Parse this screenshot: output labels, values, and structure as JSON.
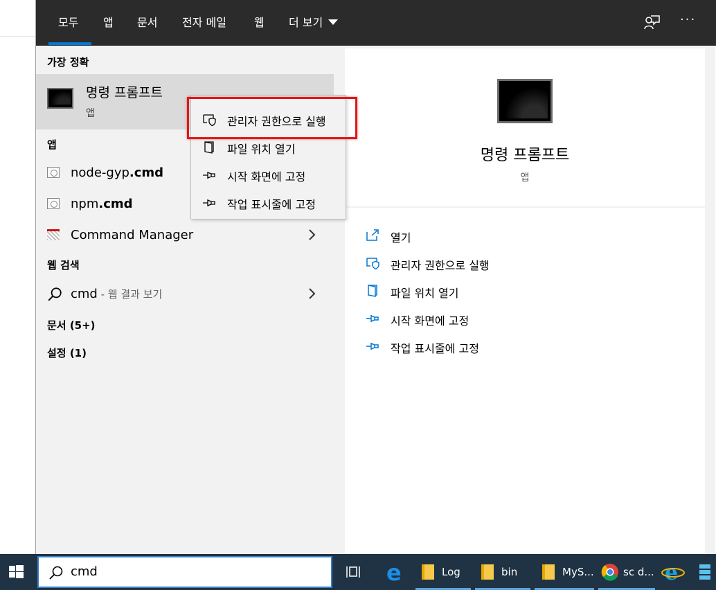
{
  "tabs": [
    {
      "label": "모두",
      "active": true
    },
    {
      "label": "앱"
    },
    {
      "label": "문서"
    },
    {
      "label": "전자 메일"
    },
    {
      "label": "웹"
    },
    {
      "label": "더 보기"
    }
  ],
  "top_icons": [
    "feedback-icon",
    "more-options-icon"
  ],
  "more_options_label": "···",
  "results": {
    "best_match_header": "가장 정확",
    "best_match": {
      "title": "명령 프롬프트",
      "subtitle": "앱",
      "icon": "command-prompt-icon"
    },
    "apps_header": "앱",
    "apps": [
      {
        "name": "node-gyp",
        "ext": ".cmd",
        "icon": "batch-file-icon"
      },
      {
        "name": "npm",
        "ext": ".cmd",
        "icon": "batch-file-icon"
      },
      {
        "name": "Command Manager",
        "icon": "command-manager-icon",
        "has_submenu": true
      }
    ],
    "web_header": "웹 검색",
    "web": {
      "query": "cmd",
      "suffix": " - 웹 결과 보기",
      "icon": "search-icon"
    },
    "docs_header": "문서 (5+)",
    "settings_header": "설정 (1)"
  },
  "context_menu": [
    {
      "label": "관리자 권한으로 실행",
      "icon": "shield-icon",
      "highlighted": true
    },
    {
      "label": "파일 위치 열기",
      "icon": "file-location-icon"
    },
    {
      "label": "시작 화면에 고정",
      "icon": "pin-icon"
    },
    {
      "label": "작업 표시줄에 고정",
      "icon": "pin-icon"
    }
  ],
  "details": {
    "title": "명령 프롬프트",
    "subtitle": "앱",
    "actions": [
      {
        "label": "열기",
        "icon": "open-icon"
      },
      {
        "label": "관리자 권한으로 실행",
        "icon": "shield-icon"
      },
      {
        "label": "파일 위치 열기",
        "icon": "file-location-icon"
      },
      {
        "label": "시작 화면에 고정",
        "icon": "pin-icon"
      },
      {
        "label": "작업 표시줄에 고정",
        "icon": "pin-icon"
      }
    ]
  },
  "taskbar": {
    "search_value": "cmd",
    "items": [
      {
        "label": "",
        "icon": "task-view-icon"
      },
      {
        "label": "",
        "icon": "edge-icon"
      },
      {
        "label": "Log",
        "icon": "folder-icon"
      },
      {
        "label": "bin",
        "icon": "folder-icon"
      },
      {
        "label": "MyS...",
        "icon": "folder-icon"
      },
      {
        "label": "sc d...",
        "icon": "chrome-icon"
      },
      {
        "label": "",
        "icon": "internet-explorer-icon"
      },
      {
        "label": "",
        "icon": "server-icon"
      }
    ]
  },
  "colors": {
    "accent": "#0078d7",
    "topbar": "#2b2b2b",
    "taskbar": "#1f3344",
    "highlight_border": "#e01818"
  }
}
